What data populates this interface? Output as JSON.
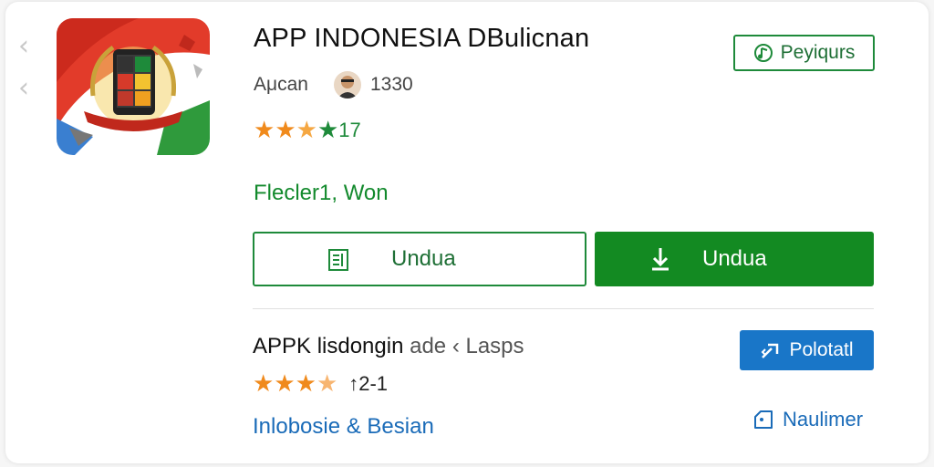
{
  "app": {
    "title": "APP INDONESIA DBulicnan",
    "developer": "Aμcan",
    "developer_count": "1330",
    "rating_value": "17",
    "publisher_link": "Flecler1, Won"
  },
  "header": {
    "follow_label": "Peyiqurs"
  },
  "actions": {
    "secondary_label": "Undua",
    "primary_label": "Undua"
  },
  "related": {
    "title_main": "APPK lisdongin",
    "title_faded": "ade ‹ Lasps",
    "rating_value": "↑2-1",
    "category": "Inlobosie & Besian",
    "blue_button_label": "Polotatl",
    "text_button_label": "Naulimer"
  },
  "colors": {
    "green_primary": "#138a22",
    "green_text": "#1e6f35",
    "blue_accent": "#1976c8",
    "star_orange": "#f08a1c",
    "star_green": "#1e8a3a"
  },
  "icons": {
    "nav": "chevron-left-icon",
    "follow": "music-note-icon",
    "secondary": "document-icon",
    "primary": "download-icon",
    "blue_button": "share-icon",
    "text_button": "tag-icon"
  },
  "ratings": {
    "first": {
      "filled": 4,
      "total": 4
    },
    "second": {
      "filled": 4,
      "total": 4
    }
  }
}
